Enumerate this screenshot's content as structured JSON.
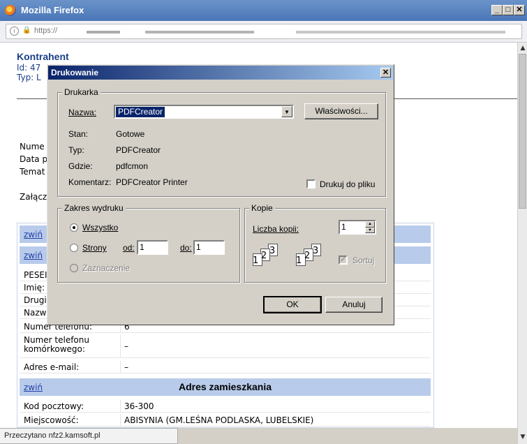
{
  "browser": {
    "window_title": "Mozilla Firefox",
    "url_prefix": "https://",
    "status": "Przeczytano nfz2.kamsoft.pl"
  },
  "page": {
    "heading": "Kontrahent",
    "id_label": "Id: 47",
    "typ_label": "Typ: L",
    "bg_labels": [
      "Nume",
      "Data p",
      "Temat",
      "Załącz"
    ],
    "sections": {
      "top_toggle": "zwiń",
      "contact_toggle": "zwiń",
      "address_toggle": "zwiń",
      "address_title": "Adres zamieszkania"
    },
    "person_rows": [
      "PESEI",
      "Imię:",
      "Drugi",
      "Nazw"
    ],
    "contact_rows": [
      {
        "key": "Numer telefonu:",
        "value": "6"
      },
      {
        "key": "Numer telefonu komórkowego:",
        "value": "–"
      },
      {
        "key": "Adres e-mail:",
        "value": "–"
      }
    ],
    "address_rows": [
      {
        "key": "Kod pocztowy:",
        "value": "36-300"
      },
      {
        "key": "Miejscowość:",
        "value": "ABISYNIA (GM.LEŚNA PODLASKA, LUBELSKIE)"
      }
    ]
  },
  "dialog": {
    "title": "Drukowanie",
    "printer_group": "Drukarka",
    "name_label": "Nazwa:",
    "name_value": "PDFCreator",
    "properties_button": "Właściwości...",
    "status_label": "Stan:",
    "status_value": "Gotowe",
    "type_label": "Typ:",
    "type_value": "PDFCreator",
    "where_label": "Gdzie:",
    "where_value": "pdfcmon",
    "comment_label": "Komentarz:",
    "comment_value": "PDFCreator Printer",
    "print_to_file": "Drukuj do pliku",
    "range_group": "Zakres wydruku",
    "range_all": "Wszystko",
    "range_pages": "Strony",
    "from_label": "od:",
    "from_value": "1",
    "to_label": "do:",
    "to_value": "1",
    "range_selection": "Zaznaczenie",
    "copies_group": "Kopie",
    "copies_label": "Liczba kopii:",
    "copies_value": "1",
    "collate": "Sortuj",
    "copy_numbers": [
      "1",
      "2",
      "3",
      "1",
      "2",
      "3"
    ],
    "ok_button": "OK",
    "cancel_button": "Anuluj"
  }
}
